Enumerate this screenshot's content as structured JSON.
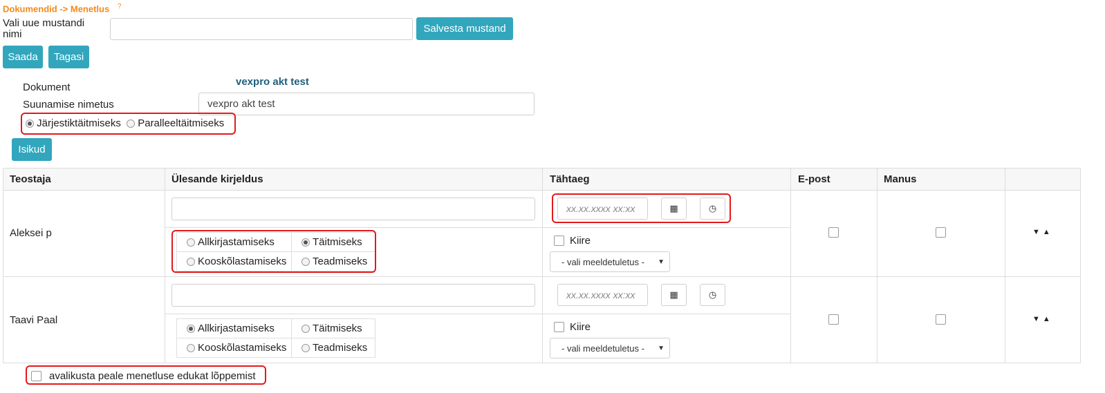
{
  "breadcrumb": {
    "text": "Dokumendid -> Menetlus",
    "help": "?"
  },
  "draft": {
    "label": "Vali uue mustandi nimi",
    "input_value": "",
    "save_label": "Salvesta mustand"
  },
  "actions": {
    "send_label": "Saada",
    "back_label": "Tagasi"
  },
  "document": {
    "label": "Dokument",
    "value": "vexpro akt test",
    "routing_label": "Suunamise nimetus",
    "routing_value": "vexpro akt test"
  },
  "mode": {
    "sequential": "Järjestiktäitmiseks",
    "parallel": "Paralleeltäitmiseks",
    "selected": "sequential"
  },
  "persons_button": "Isikud",
  "table": {
    "headers": [
      "Teostaja",
      "Ülesande kirjeldus",
      "Tähtaeg",
      "E-post",
      "Manus",
      ""
    ],
    "date_placeholder": "xx.xx.xxxx xx:xx",
    "options": [
      "Allkirjastamiseks",
      "Täitmiseks",
      "Kooskõlastamiseks",
      "Teadmiseks"
    ],
    "urgent_label": "Kiire",
    "reminder_placeholder": "- vali meeldetuletus -",
    "rows": [
      {
        "name": "Aleksei p",
        "description": "",
        "selected_option": "Täitmiseks"
      },
      {
        "name": "Taavi Paal",
        "description": "",
        "selected_option": "Allkirjastamiseks"
      }
    ]
  },
  "footer": {
    "auto_cancel_label": "avalikusta peale menetluse edukat lõppemist"
  },
  "colors": {
    "accent": "#31a6bd",
    "breadcrumb": "#f28a1a",
    "doc_title": "#1f5f7a",
    "highlight": "#e2191c"
  }
}
